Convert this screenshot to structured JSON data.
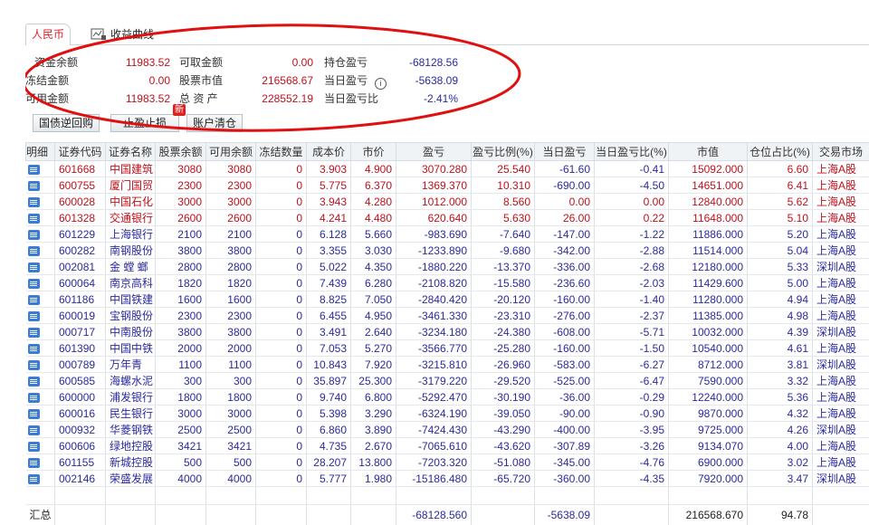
{
  "tabs": {
    "active": "人民币",
    "curve": "收益曲线"
  },
  "summary": {
    "fund_balance_label": "资金余额",
    "fund_balance": "11983.52",
    "withdrawable_label": "可取金额",
    "withdrawable": "0.00",
    "position_pnl_label": "持仓盈亏",
    "position_pnl": "-68128.56",
    "frozen_label": "冻结金额",
    "frozen": "0.00",
    "stock_value_label": "股票市值",
    "stock_value": "216568.67",
    "daily_pnl_label": "当日盈亏",
    "daily_pnl": "-5638.09",
    "available_label": "可用金额",
    "available": "11983.52",
    "total_assets_label": "总 资 产",
    "total_assets": "228552.19",
    "daily_pnl_ratio_label": "当日盈亏比",
    "daily_pnl_ratio": "-2.41%"
  },
  "buttons": {
    "repo": "国债逆回购",
    "stop": "止盈止损",
    "new_badge": "新",
    "clear": "账户清仓"
  },
  "columns": [
    "明细",
    "证券代码",
    "证券名称",
    "股票余额",
    "可用余额",
    "冻结数量",
    "成本价",
    "市价",
    "盈亏",
    "盈亏比例(%)",
    "当日盈亏",
    "当日盈亏比(%)",
    "市值",
    "仓位占比(%)",
    "交易市场"
  ],
  "rows": [
    [
      "601668",
      "中国建筑",
      "3080",
      "3080",
      "0",
      "3.903",
      "4.900",
      "3070.280",
      "25.540",
      "-61.60",
      "-0.41",
      "15092.000",
      "6.60",
      "上海A股"
    ],
    [
      "600755",
      "厦门国贸",
      "2300",
      "2300",
      "0",
      "5.775",
      "6.370",
      "1369.370",
      "10.310",
      "-690.00",
      "-4.50",
      "14651.000",
      "6.41",
      "上海A股"
    ],
    [
      "600028",
      "中国石化",
      "3000",
      "3000",
      "0",
      "3.943",
      "4.280",
      "1012.000",
      "8.560",
      "0.00",
      "0.00",
      "12840.000",
      "5.62",
      "上海A股"
    ],
    [
      "601328",
      "交通银行",
      "2600",
      "2600",
      "0",
      "4.241",
      "4.480",
      "620.640",
      "5.630",
      "26.00",
      "0.22",
      "11648.000",
      "5.10",
      "上海A股"
    ],
    [
      "601229",
      "上海银行",
      "2100",
      "2100",
      "0",
      "6.128",
      "5.660",
      "-983.690",
      "-7.640",
      "-147.00",
      "-1.22",
      "11886.000",
      "5.20",
      "上海A股"
    ],
    [
      "600282",
      "南钢股份",
      "3800",
      "3800",
      "0",
      "3.355",
      "3.030",
      "-1233.890",
      "-9.680",
      "-342.00",
      "-2.88",
      "11514.000",
      "5.04",
      "上海A股"
    ],
    [
      "002081",
      "金 螳 螂",
      "2800",
      "2800",
      "0",
      "5.022",
      "4.350",
      "-1880.220",
      "-13.370",
      "-336.00",
      "-2.68",
      "12180.000",
      "5.33",
      "深圳A股"
    ],
    [
      "600064",
      "南京高科",
      "1820",
      "1820",
      "0",
      "7.439",
      "6.280",
      "-2108.820",
      "-15.580",
      "-236.60",
      "-2.03",
      "11429.600",
      "5.00",
      "上海A股"
    ],
    [
      "601186",
      "中国铁建",
      "1600",
      "1600",
      "0",
      "8.825",
      "7.050",
      "-2840.420",
      "-20.120",
      "-160.00",
      "-1.40",
      "11280.000",
      "4.94",
      "上海A股"
    ],
    [
      "600019",
      "宝钢股份",
      "2300",
      "2300",
      "0",
      "6.455",
      "4.950",
      "-3461.330",
      "-23.310",
      "-276.00",
      "-2.37",
      "11385.000",
      "4.98",
      "上海A股"
    ],
    [
      "000717",
      "中南股份",
      "3800",
      "3800",
      "0",
      "3.491",
      "2.640",
      "-3234.180",
      "-24.380",
      "-608.00",
      "-5.71",
      "10032.000",
      "4.39",
      "深圳A股"
    ],
    [
      "601390",
      "中国中铁",
      "2000",
      "2000",
      "0",
      "7.053",
      "5.270",
      "-3566.770",
      "-25.280",
      "-160.00",
      "-1.50",
      "10540.000",
      "4.61",
      "上海A股"
    ],
    [
      "000789",
      "万年青",
      "1100",
      "1100",
      "0",
      "10.843",
      "7.920",
      "-3215.810",
      "-26.960",
      "-583.00",
      "-6.27",
      "8712.000",
      "3.81",
      "深圳A股"
    ],
    [
      "600585",
      "海螺水泥",
      "300",
      "300",
      "0",
      "35.897",
      "25.300",
      "-3179.220",
      "-29.520",
      "-525.00",
      "-6.47",
      "7590.000",
      "3.32",
      "上海A股"
    ],
    [
      "600000",
      "浦发银行",
      "1800",
      "1800",
      "0",
      "9.740",
      "6.800",
      "-5292.470",
      "-30.190",
      "-36.00",
      "-0.29",
      "12240.000",
      "5.36",
      "上海A股"
    ],
    [
      "600016",
      "民生银行",
      "3000",
      "3000",
      "0",
      "5.398",
      "3.290",
      "-6324.190",
      "-39.050",
      "-90.00",
      "-0.90",
      "9870.000",
      "4.32",
      "上海A股"
    ],
    [
      "000932",
      "华菱钢铁",
      "2500",
      "2500",
      "0",
      "6.860",
      "3.890",
      "-7424.430",
      "-43.290",
      "-400.00",
      "-3.95",
      "9725.000",
      "4.26",
      "深圳A股"
    ],
    [
      "600606",
      "绿地控股",
      "3421",
      "3421",
      "0",
      "4.735",
      "2.670",
      "-7065.610",
      "-43.620",
      "-307.89",
      "-3.26",
      "9134.070",
      "4.00",
      "上海A股"
    ],
    [
      "601155",
      "新城控股",
      "500",
      "500",
      "0",
      "28.207",
      "13.800",
      "-7203.320",
      "-51.080",
      "-345.00",
      "-4.76",
      "6900.000",
      "3.02",
      "上海A股"
    ],
    [
      "002146",
      "荣盛发展",
      "4000",
      "4000",
      "0",
      "5.777",
      "1.980",
      "-15186.480",
      "-65.720",
      "-360.00",
      "-4.35",
      "7920.000",
      "3.47",
      "深圳A股"
    ]
  ],
  "total": {
    "label": "汇总",
    "pnl": "-68128.560",
    "daily_pnl": "-5638.09",
    "market_value": "216568.670",
    "position_ratio": "94.78"
  },
  "colors": {
    "up": "#c0101a",
    "down": "#2a2aa0",
    "annotation": "#e01010"
  }
}
